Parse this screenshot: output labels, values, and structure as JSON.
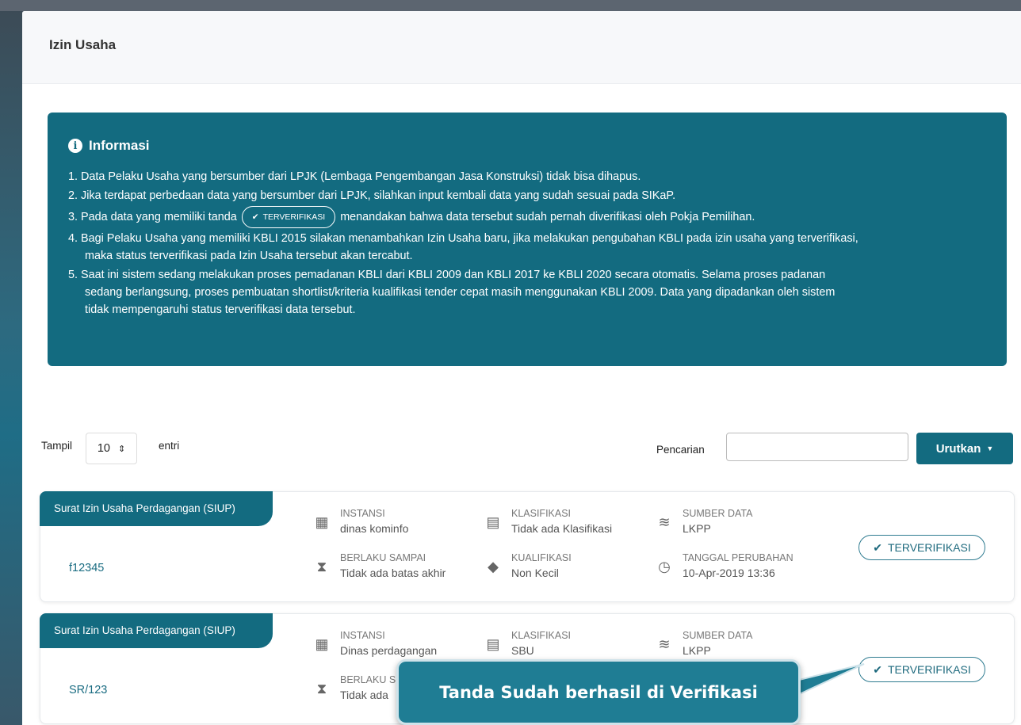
{
  "page_title": "Izin Usaha",
  "info": {
    "heading": "Informasi",
    "items": [
      "1. Data Pelaku Usaha yang bersumber dari LPJK (Lembaga Pengembangan Jasa Konstruksi) tidak bisa dihapus.",
      "2. Jika terdapat perbedaan data yang bersumber dari LPJK, silahkan input kembali data yang sudah sesuai pada SIKaP.",
      "menandakan bahwa data tersebut sudah pernah diverifikasi oleh Pokja Pemilihan.",
      "4. Bagi Pelaku Usaha yang memiliki KBLI 2015 silakan menambahkan Izin Usaha baru, jika melakukan pengubahan KBLI pada izin usaha yang terverifikasi, maka status terverifikasi pada Izin Usaha tersebut akan tercabut.",
      "5. Saat ini sistem sedang melakukan proses pemadanan KBLI dari KBLI 2009 dan KBLI 2017 ke KBLI 2020 secara otomatis. Selama proses padanan sedang berlangsung, proses pembuatan shortlist/kriteria kualifikasi tender cepat masih menggunakan KBLI 2009. Data yang dipadankan oleh sistem tidak mempengaruhi status terverifikasi data tersebut."
    ],
    "item3_prefix": "3. Pada data yang memiliki tanda",
    "item4_line1": "4. Bagi Pelaku Usaha yang memiliki KBLI 2015 silakan menambahkan Izin Usaha baru, jika melakukan pengubahan KBLI pada izin usaha yang terverifikasi,",
    "item4_line2": "maka status terverifikasi pada Izin Usaha tersebut akan tercabut.",
    "item5_line1": "5. Saat ini sistem sedang melakukan proses pemadanan KBLI dari KBLI 2009 dan KBLI 2017 ke KBLI 2020 secara otomatis. Selama proses padanan",
    "item5_line2": "sedang berlangsung, proses pembuatan shortlist/kriteria kualifikasi tender cepat masih menggunakan KBLI 2009. Data yang dipadankan oleh sistem",
    "item5_line3": "tidak mempengaruhi status terverifikasi data tersebut.",
    "badge_label": "TERVERIFIKASI"
  },
  "controls": {
    "show_label": "Tampil",
    "show_value": "10",
    "entries_label": "entri",
    "search_label": "Pencarian",
    "search_value": "",
    "sort_label": "Urutkan"
  },
  "cards": [
    {
      "type": "Surat Izin Usaha Perdagangan (SIUP)",
      "number": "f12345",
      "instansi_label": "INSTANSI",
      "instansi": "dinas kominfo",
      "klasifikasi_label": "KLASIFIKASI",
      "klasifikasi": "Tidak ada Klasifikasi",
      "sumber_label": "SUMBER DATA",
      "sumber": "LKPP",
      "berlaku_label": "BERLAKU SAMPAI",
      "berlaku": "Tidak ada batas akhir",
      "kualifikasi_label": "KUALIFIKASI",
      "kualifikasi": "Non Kecil",
      "tanggal_label": "TANGGAL PERUBAHAN",
      "tanggal": "10-Apr-2019 13:36",
      "status": "TERVERIFIKASI"
    },
    {
      "type": "Surat Izin Usaha Perdagangan (SIUP)",
      "number": "SR/123",
      "instansi_label": "INSTANSI",
      "instansi": "Dinas perdagangan",
      "klasifikasi_label": "KLASIFIKASI",
      "klasifikasi": "SBU",
      "sumber_label": "SUMBER DATA",
      "sumber": "LKPP",
      "berlaku_label": "BERLAKU S",
      "berlaku": "Tidak ada",
      "status": "TERVERIFIKASI"
    }
  ],
  "callout": "Tanda Sudah berhasil di Verifikasi",
  "colors": {
    "primary": "#136b80",
    "callout": "#1f7d94"
  }
}
